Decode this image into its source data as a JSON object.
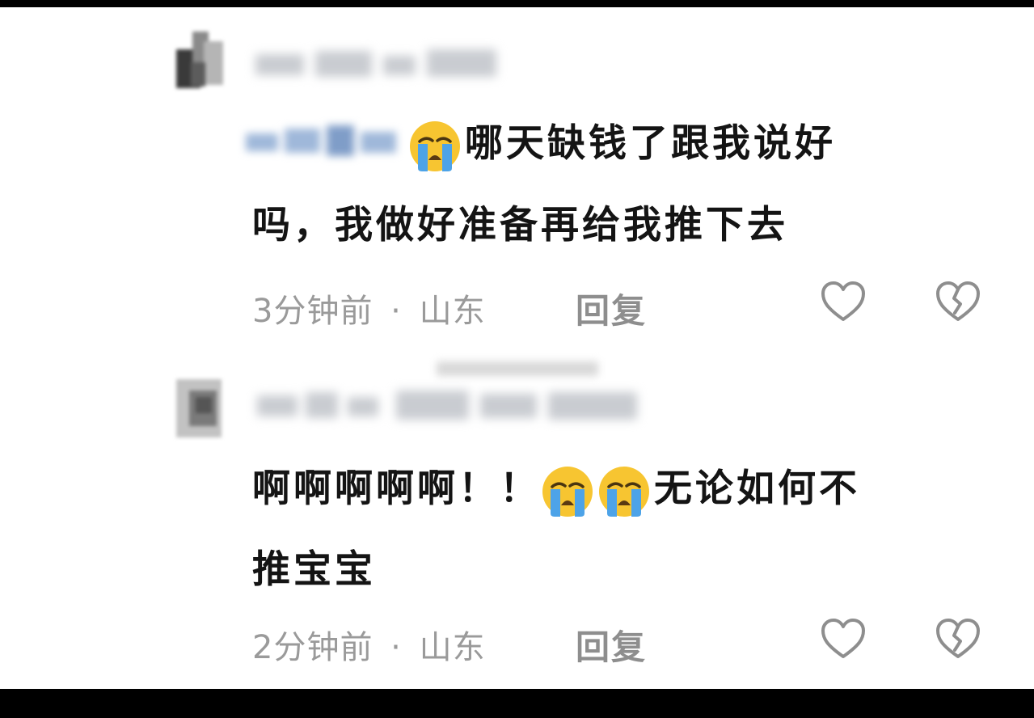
{
  "comments": [
    {
      "text_lines": [
        "哪天缺钱了跟我说好",
        "吗，我做好准备再给我推下去"
      ],
      "emoji": "loudly-crying-face",
      "time": "3分钟前",
      "separator": "·",
      "location": "山东",
      "reply_label": "回复"
    },
    {
      "text_lines": [
        "啊啊啊啊啊！！",
        "无论如何不",
        "推宝宝"
      ],
      "emoji": "loudly-crying-face",
      "time": "2分钟前",
      "separator": "·",
      "location": "山东",
      "reply_label": "回复"
    }
  ],
  "icons": {
    "like": "heart-outline-icon",
    "dislike": "broken-heart-icon"
  },
  "colors": {
    "meta": "#9a9a9a",
    "text": "#141414",
    "emoji": "#f7c531",
    "tears": "#4da3e8"
  }
}
